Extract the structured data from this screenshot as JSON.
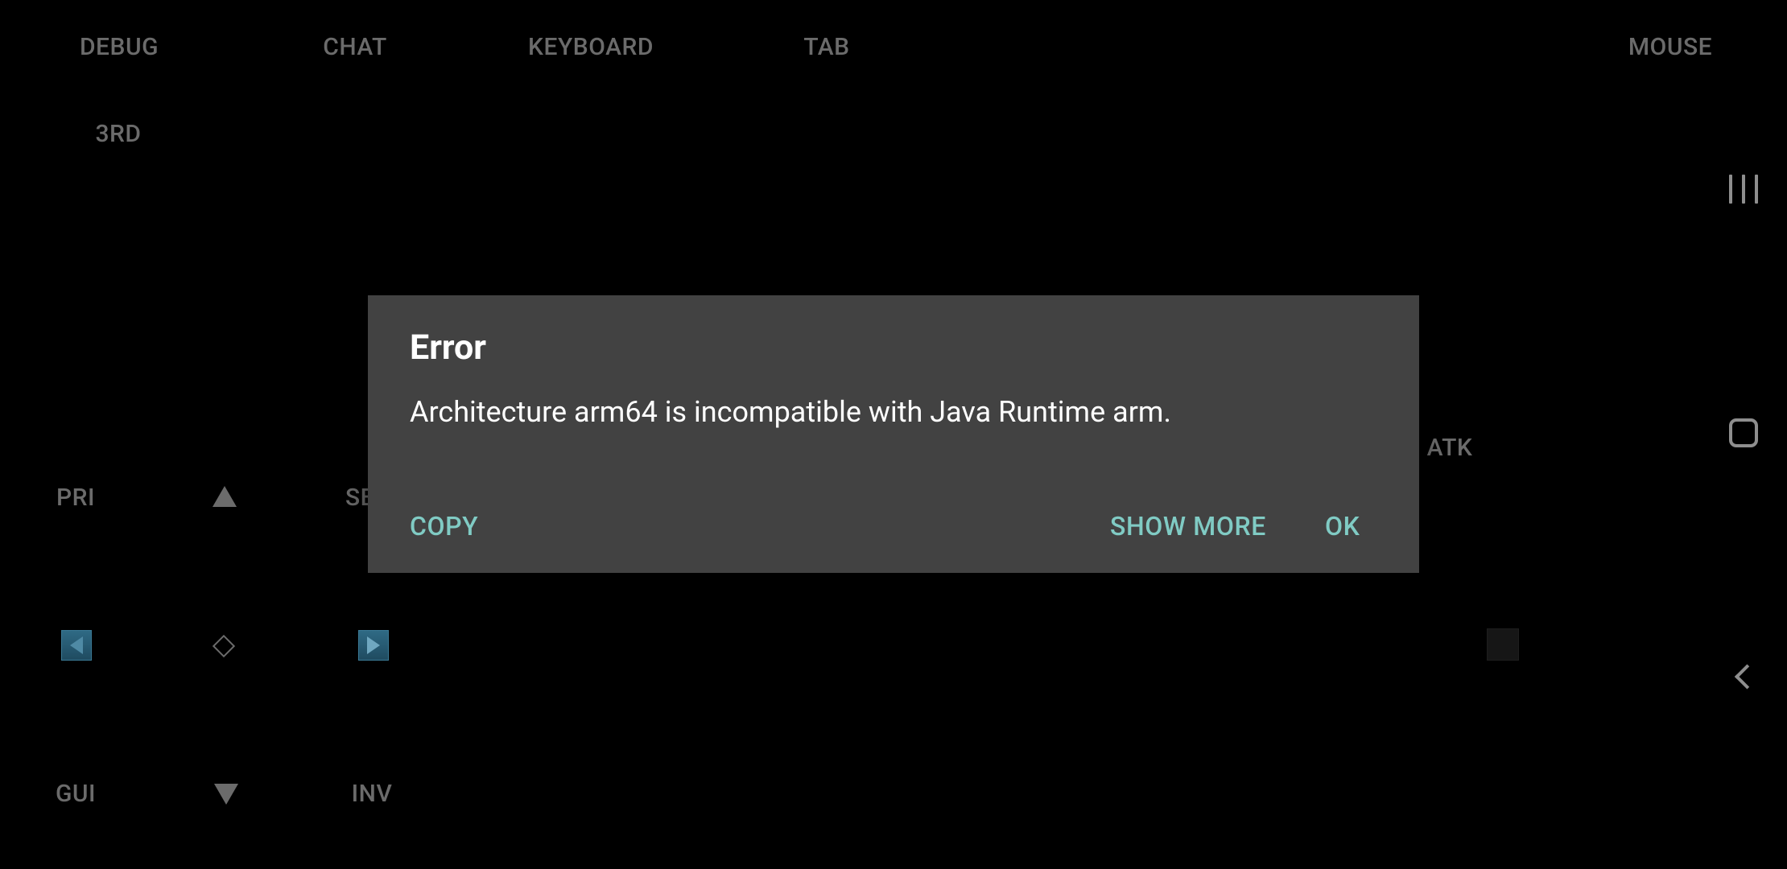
{
  "overlay": {
    "top_controls": {
      "debug": "DEBUG",
      "chat": "CHAT",
      "keyboard": "KEYBOARD",
      "tab": "TAB",
      "mouse": "MOUSE",
      "third": "3RD"
    },
    "left_controls": {
      "pri": "PRI",
      "sec_partial": "SE",
      "gui": "GUI",
      "inv": "INV"
    },
    "right_controls": {
      "atk": "ATK"
    },
    "icons": {
      "dpad_up": "arrow-up-icon",
      "dpad_down": "arrow-down-icon",
      "dpad_left": "arrow-left-icon",
      "dpad_right": "arrow-right-icon",
      "dpad_center": "diamond-icon"
    }
  },
  "navbar": {
    "icons": [
      "recent-apps-icon",
      "home-icon",
      "back-icon"
    ]
  },
  "dialog": {
    "title": "Error",
    "message": "Architecture arm64 is incompatible with Java Runtime arm.",
    "buttons": {
      "copy": "COPY",
      "show_more": "SHOW MORE",
      "ok": "OK"
    }
  },
  "colors": {
    "background": "#000000",
    "dialog_bg": "#424242",
    "accent": "#80cbc4",
    "control_text": "#6b6b6b"
  }
}
